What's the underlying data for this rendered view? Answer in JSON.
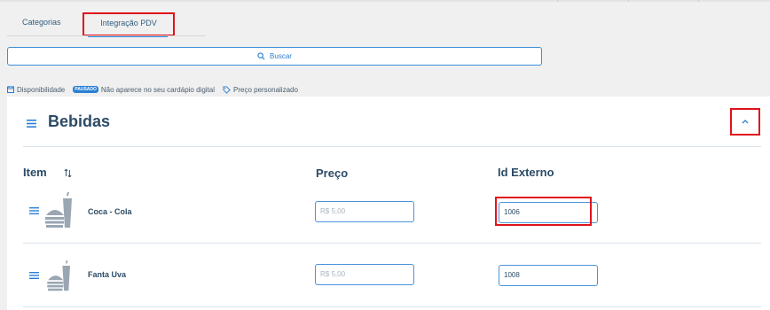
{
  "tabs": [
    {
      "label": "Categorias"
    },
    {
      "label": "Integração PDV"
    }
  ],
  "search": {
    "label": "Buscar"
  },
  "legend": {
    "availability": "Disponibilidade",
    "paused_badge": "PAUSADO",
    "hidden": "Não aparece no seu cardápio digital",
    "custom_price": "Preço personalizado"
  },
  "category": {
    "title": "Bebidas",
    "columns": {
      "item": "Item",
      "price": "Preço",
      "external_id": "Id Externo"
    },
    "products": [
      {
        "name": "Coca - Cola",
        "price": "R$ 5,00",
        "external_id": "1006"
      },
      {
        "name": "Fanta Uva",
        "price": "R$ 5,00",
        "external_id": "1008"
      }
    ]
  },
  "colors": {
    "accent": "#2a7fd4",
    "highlight": "#e0121b",
    "text": "#2c4b66"
  }
}
